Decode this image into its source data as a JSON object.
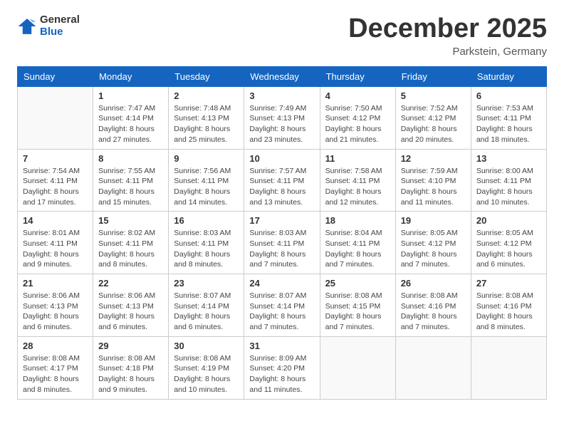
{
  "header": {
    "logo_general": "General",
    "logo_blue": "Blue",
    "month": "December 2025",
    "location": "Parkstein, Germany"
  },
  "days_of_week": [
    "Sunday",
    "Monday",
    "Tuesday",
    "Wednesday",
    "Thursday",
    "Friday",
    "Saturday"
  ],
  "weeks": [
    [
      {
        "day": "",
        "sunrise": "",
        "sunset": "",
        "daylight": ""
      },
      {
        "day": "1",
        "sunrise": "7:47 AM",
        "sunset": "4:14 PM",
        "daylight": "8 hours and 27 minutes."
      },
      {
        "day": "2",
        "sunrise": "7:48 AM",
        "sunset": "4:13 PM",
        "daylight": "8 hours and 25 minutes."
      },
      {
        "day": "3",
        "sunrise": "7:49 AM",
        "sunset": "4:13 PM",
        "daylight": "8 hours and 23 minutes."
      },
      {
        "day": "4",
        "sunrise": "7:50 AM",
        "sunset": "4:12 PM",
        "daylight": "8 hours and 21 minutes."
      },
      {
        "day": "5",
        "sunrise": "7:52 AM",
        "sunset": "4:12 PM",
        "daylight": "8 hours and 20 minutes."
      },
      {
        "day": "6",
        "sunrise": "7:53 AM",
        "sunset": "4:11 PM",
        "daylight": "8 hours and 18 minutes."
      }
    ],
    [
      {
        "day": "7",
        "sunrise": "7:54 AM",
        "sunset": "4:11 PM",
        "daylight": "8 hours and 17 minutes."
      },
      {
        "day": "8",
        "sunrise": "7:55 AM",
        "sunset": "4:11 PM",
        "daylight": "8 hours and 15 minutes."
      },
      {
        "day": "9",
        "sunrise": "7:56 AM",
        "sunset": "4:11 PM",
        "daylight": "8 hours and 14 minutes."
      },
      {
        "day": "10",
        "sunrise": "7:57 AM",
        "sunset": "4:11 PM",
        "daylight": "8 hours and 13 minutes."
      },
      {
        "day": "11",
        "sunrise": "7:58 AM",
        "sunset": "4:11 PM",
        "daylight": "8 hours and 12 minutes."
      },
      {
        "day": "12",
        "sunrise": "7:59 AM",
        "sunset": "4:10 PM",
        "daylight": "8 hours and 11 minutes."
      },
      {
        "day": "13",
        "sunrise": "8:00 AM",
        "sunset": "4:11 PM",
        "daylight": "8 hours and 10 minutes."
      }
    ],
    [
      {
        "day": "14",
        "sunrise": "8:01 AM",
        "sunset": "4:11 PM",
        "daylight": "8 hours and 9 minutes."
      },
      {
        "day": "15",
        "sunrise": "8:02 AM",
        "sunset": "4:11 PM",
        "daylight": "8 hours and 8 minutes."
      },
      {
        "day": "16",
        "sunrise": "8:03 AM",
        "sunset": "4:11 PM",
        "daylight": "8 hours and 8 minutes."
      },
      {
        "day": "17",
        "sunrise": "8:03 AM",
        "sunset": "4:11 PM",
        "daylight": "8 hours and 7 minutes."
      },
      {
        "day": "18",
        "sunrise": "8:04 AM",
        "sunset": "4:11 PM",
        "daylight": "8 hours and 7 minutes."
      },
      {
        "day": "19",
        "sunrise": "8:05 AM",
        "sunset": "4:12 PM",
        "daylight": "8 hours and 7 minutes."
      },
      {
        "day": "20",
        "sunrise": "8:05 AM",
        "sunset": "4:12 PM",
        "daylight": "8 hours and 6 minutes."
      }
    ],
    [
      {
        "day": "21",
        "sunrise": "8:06 AM",
        "sunset": "4:13 PM",
        "daylight": "8 hours and 6 minutes."
      },
      {
        "day": "22",
        "sunrise": "8:06 AM",
        "sunset": "4:13 PM",
        "daylight": "8 hours and 6 minutes."
      },
      {
        "day": "23",
        "sunrise": "8:07 AM",
        "sunset": "4:14 PM",
        "daylight": "8 hours and 6 minutes."
      },
      {
        "day": "24",
        "sunrise": "8:07 AM",
        "sunset": "4:14 PM",
        "daylight": "8 hours and 7 minutes."
      },
      {
        "day": "25",
        "sunrise": "8:08 AM",
        "sunset": "4:15 PM",
        "daylight": "8 hours and 7 minutes."
      },
      {
        "day": "26",
        "sunrise": "8:08 AM",
        "sunset": "4:16 PM",
        "daylight": "8 hours and 7 minutes."
      },
      {
        "day": "27",
        "sunrise": "8:08 AM",
        "sunset": "4:16 PM",
        "daylight": "8 hours and 8 minutes."
      }
    ],
    [
      {
        "day": "28",
        "sunrise": "8:08 AM",
        "sunset": "4:17 PM",
        "daylight": "8 hours and 8 minutes."
      },
      {
        "day": "29",
        "sunrise": "8:08 AM",
        "sunset": "4:18 PM",
        "daylight": "8 hours and 9 minutes."
      },
      {
        "day": "30",
        "sunrise": "8:08 AM",
        "sunset": "4:19 PM",
        "daylight": "8 hours and 10 minutes."
      },
      {
        "day": "31",
        "sunrise": "8:09 AM",
        "sunset": "4:20 PM",
        "daylight": "8 hours and 11 minutes."
      },
      {
        "day": "",
        "sunrise": "",
        "sunset": "",
        "daylight": ""
      },
      {
        "day": "",
        "sunrise": "",
        "sunset": "",
        "daylight": ""
      },
      {
        "day": "",
        "sunrise": "",
        "sunset": "",
        "daylight": ""
      }
    ]
  ],
  "labels": {
    "sunrise_prefix": "Sunrise: ",
    "sunset_prefix": "Sunset: ",
    "daylight_prefix": "Daylight: "
  }
}
